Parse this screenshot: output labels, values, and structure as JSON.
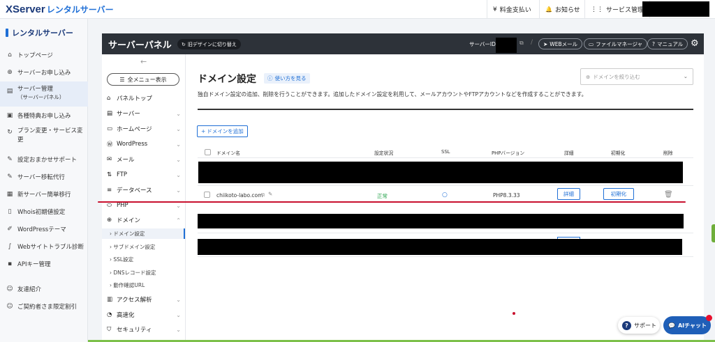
{
  "topbar": {
    "logo_main": "XServer",
    "logo_sub": "レンタルサーバー",
    "buttons": [
      {
        "icon": "yen-icon",
        "glyph": "¥",
        "label": "料金支払い"
      },
      {
        "icon": "bell-icon",
        "glyph": "🔔",
        "label": "お知らせ"
      },
      {
        "icon": "grid-icon",
        "glyph": "⋮⋮",
        "label": "サービス管理"
      }
    ]
  },
  "sidebar": {
    "title": "レンタルサーバー",
    "items": [
      {
        "label": "トップページ"
      },
      {
        "label": "サーバーお申し込み"
      },
      {
        "label": "サーバー管理",
        "label2": "（サーバーパネル）"
      },
      {
        "label": "各種特典お申し込み"
      },
      {
        "label": "プラン変更・サービス変",
        "label2": "更"
      },
      {
        "label": "設定おまかせサポート"
      },
      {
        "label": "サーバー移転代行"
      },
      {
        "label": "新サーバー簡単移行"
      },
      {
        "label": "Whois初期値設定"
      },
      {
        "label": "WordPressテーマ"
      },
      {
        "label": "Webサイトトラブル診断"
      },
      {
        "label": "APIキー管理"
      },
      {
        "label": "友達紹介"
      },
      {
        "label": "ご契約者さま限定割引"
      }
    ]
  },
  "panel": {
    "title": "サーバーパネル",
    "old_design": "旧デザインに切り替え",
    "server_id_label": "サーバーID",
    "buttons": {
      "webmail": "WEBメール",
      "filemanager": "ファイルマネージャ",
      "manual": "マニュアル"
    }
  },
  "subnav": {
    "all_menu": "全メニュー表示",
    "items": [
      {
        "label": "パネルトップ",
        "chev": ""
      },
      {
        "label": "サーバー",
        "chev": "⌄"
      },
      {
        "label": "ホームページ",
        "chev": "⌄"
      },
      {
        "label": "WordPress",
        "chev": "⌄"
      },
      {
        "label": "メール",
        "chev": "⌄"
      },
      {
        "label": "FTP",
        "chev": "⌄"
      },
      {
        "label": "データベース",
        "chev": "⌄"
      },
      {
        "label": "PHP",
        "chev": "⌄"
      },
      {
        "label": "ドメイン",
        "chev": "⌃"
      }
    ],
    "sub_items": [
      {
        "label": "ドメイン設定"
      },
      {
        "label": "サブドメイン設定"
      },
      {
        "label": "SSL設定"
      },
      {
        "label": "DNSレコード設定"
      },
      {
        "label": "動作確認URL"
      }
    ],
    "bottom_items": [
      {
        "label": "アクセス解析",
        "chev": "⌄"
      },
      {
        "label": "高速化",
        "chev": "⌄"
      },
      {
        "label": "セキュリティ",
        "chev": "⌄"
      }
    ]
  },
  "content": {
    "title": "ドメイン設定",
    "howto": "使い方を見る",
    "filter_placeholder": "ドメインを絞り込む",
    "description": "独自ドメイン設定の追加、削除を行うことができます。追加したドメイン設定を利用して、メールアカウントやFTPアカウントなどを作成することができます。",
    "add_button": "ドメインを追加",
    "columns": [
      "ドメイン名",
      "設定状況",
      "SSL",
      "PHPバージョン",
      "詳細",
      "初期化",
      "削除"
    ],
    "row": {
      "domain": "chiikoto-labo.com",
      "status": "正常",
      "ssl": "○",
      "php": "PHP8.3.33",
      "detail": "詳細",
      "reset": "初期化"
    }
  },
  "floating": {
    "support": "サポート",
    "ai_chat": "AIチャット"
  },
  "colors": {
    "accent": "#1f6fd6",
    "brand": "#1b3a7a",
    "status_ok": "#2aa44f",
    "annotation": "#c8102e"
  }
}
